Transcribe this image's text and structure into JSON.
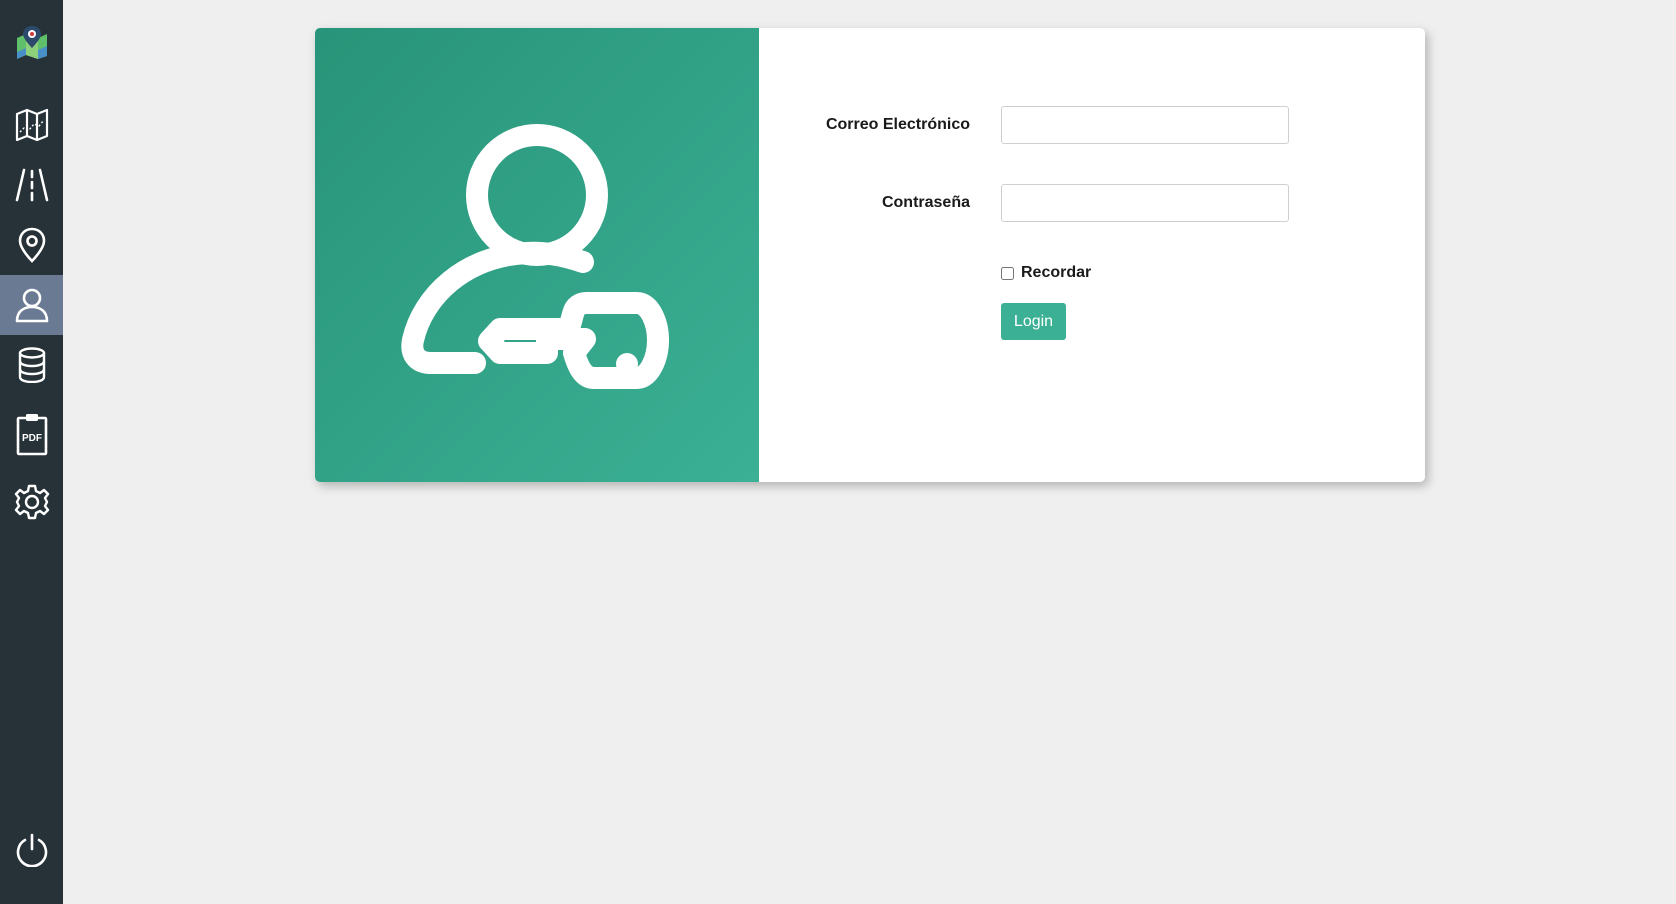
{
  "sidebar": {
    "items": [
      {
        "name": "app-logo",
        "icon": "map-pin-logo-icon"
      },
      {
        "name": "map",
        "icon": "map-icon"
      },
      {
        "name": "roads",
        "icon": "road-icon"
      },
      {
        "name": "locations",
        "icon": "location-pin-icon"
      },
      {
        "name": "users",
        "icon": "user-icon",
        "active": true
      },
      {
        "name": "database",
        "icon": "database-icon"
      },
      {
        "name": "pdf-reports",
        "icon": "pdf-clipboard-icon",
        "text": "PDF"
      },
      {
        "name": "settings",
        "icon": "gear-icon"
      },
      {
        "name": "power",
        "icon": "power-icon"
      }
    ],
    "active_color": "#6b7a93",
    "background": "#263238"
  },
  "login": {
    "illustration_icon": "user-key-icon",
    "email_label": "Correo Electrónico",
    "email_value": "",
    "password_label": "Contraseña",
    "password_value": "",
    "remember_label": "Recordar",
    "remember_checked": false,
    "login_button": "Login",
    "accent_color": "#3bb094"
  }
}
